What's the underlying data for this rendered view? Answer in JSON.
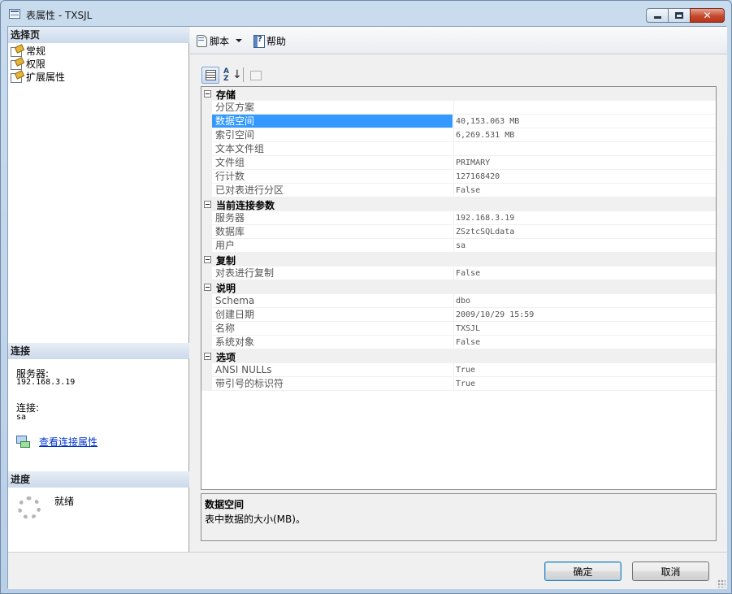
{
  "window": {
    "title": "表属性 - TXSJL",
    "minimize": "—",
    "maximize": "□",
    "close": "✕"
  },
  "left": {
    "select_page_header": "选择页",
    "pages": [
      {
        "label": "常规",
        "icon": "page-settings-icon"
      },
      {
        "label": "权限",
        "icon": "page-settings-icon"
      },
      {
        "label": "扩展属性",
        "icon": "page-settings-icon"
      }
    ],
    "connection_header": "连接",
    "server_label": "服务器:",
    "server_value": "192.168.3.19",
    "connection_label": "连接:",
    "connection_value": "sa",
    "view_connection_link": "查看连接属性",
    "progress_header": "进度",
    "progress_status": "就绪"
  },
  "toolbar": {
    "script_label": "脚本",
    "help_label": "帮助"
  },
  "grid": {
    "rows": [
      {
        "type": "category",
        "label": "存储"
      },
      {
        "type": "prop",
        "name": "分区方案",
        "value": ""
      },
      {
        "type": "prop",
        "name": "数据空间",
        "value": "40,153.063 MB",
        "selected": true
      },
      {
        "type": "prop",
        "name": "索引空间",
        "value": "6,269.531 MB"
      },
      {
        "type": "prop",
        "name": "文本文件组",
        "value": ""
      },
      {
        "type": "prop",
        "name": "文件组",
        "value": "PRIMARY"
      },
      {
        "type": "prop",
        "name": "行计数",
        "value": "127168420"
      },
      {
        "type": "prop",
        "name": "已对表进行分区",
        "value": "False"
      },
      {
        "type": "category",
        "label": "当前连接参数"
      },
      {
        "type": "prop",
        "name": "服务器",
        "value": "192.168.3.19"
      },
      {
        "type": "prop",
        "name": "数据库",
        "value": "ZSztcSQLdata"
      },
      {
        "type": "prop",
        "name": "用户",
        "value": "sa"
      },
      {
        "type": "category",
        "label": "复制"
      },
      {
        "type": "prop",
        "name": "对表进行复制",
        "value": "False"
      },
      {
        "type": "category",
        "label": "说明"
      },
      {
        "type": "prop",
        "name": "Schema",
        "value": "dbo"
      },
      {
        "type": "prop",
        "name": "创建日期",
        "value": "2009/10/29 15:59"
      },
      {
        "type": "prop",
        "name": "名称",
        "value": "TXSJL"
      },
      {
        "type": "prop",
        "name": "系统对象",
        "value": "False"
      },
      {
        "type": "category",
        "label": "选项"
      },
      {
        "type": "prop",
        "name": "ANSI NULLs",
        "value": "True"
      },
      {
        "type": "prop",
        "name": "带引号的标识符",
        "value": "True"
      }
    ]
  },
  "description": {
    "title": "数据空间",
    "text": "表中数据的大小(MB)。"
  },
  "buttons": {
    "ok": "确定",
    "cancel": "取消"
  },
  "colors": {
    "selection": "#3399ff",
    "link": "#0033cc",
    "header_band": "#ccdaea"
  }
}
